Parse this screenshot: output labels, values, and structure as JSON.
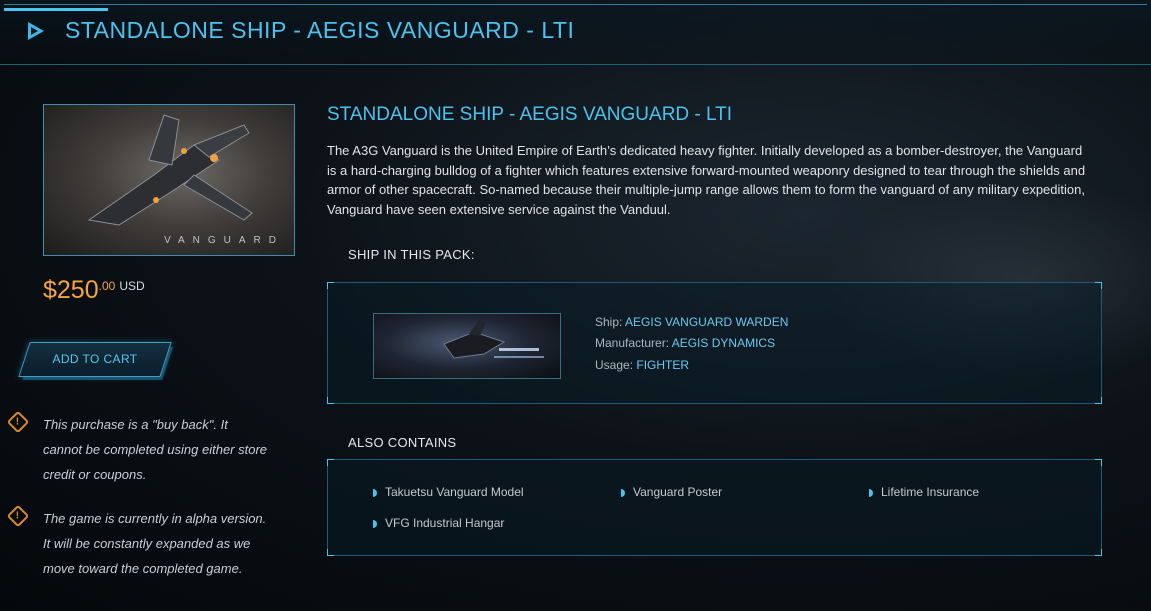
{
  "header": {
    "title": "STANDALONE SHIP - AEGIS VANGUARD - LTI"
  },
  "product": {
    "image_watermark": "VANGUARD",
    "price": {
      "main": "$250",
      "cents": ".00",
      "currency": "USD"
    },
    "add_to_cart_label": "ADD TO CART",
    "title": "STANDALONE SHIP - AEGIS VANGUARD - LTI",
    "description": "The A3G Vanguard is the United Empire of Earth’s dedicated heavy fighter. Initially developed as a bomber-destroyer, the Vanguard is a hard-charging bulldog of a fighter which features extensive forward-mounted weaponry designed to tear through the shields and armor of other spacecraft. So-named because their multiple-jump range allows them to form the vanguard of any military expedition, Vanguard have seen extensive service against the Vanduul."
  },
  "notices": [
    {
      "icon": "warning-icon",
      "text": "This purchase is a \"buy back\". It cannot be completed using either store credit or coupons."
    },
    {
      "icon": "warning-icon",
      "text": "The game is currently in alpha version. It will be constantly expanded as we move toward the completed game."
    }
  ],
  "ship_pack": {
    "label": "SHIP IN THIS PACK:",
    "ship": {
      "ship_key": "Ship:",
      "ship_value": "AEGIS VANGUARD WARDEN",
      "manufacturer_key": "Manufacturer:",
      "manufacturer_value": "AEGIS DYNAMICS",
      "usage_key": "Usage:",
      "usage_value": "FIGHTER"
    }
  },
  "also_contains": {
    "label": "ALSO CONTAINS",
    "items": [
      "Takuetsu Vanguard Model",
      "Vanguard Poster",
      "Lifetime Insurance",
      "VFG Industrial Hangar"
    ]
  },
  "colors": {
    "accent": "#4bc3ef",
    "price": "#f5a53c",
    "warning": "#d98a26"
  }
}
